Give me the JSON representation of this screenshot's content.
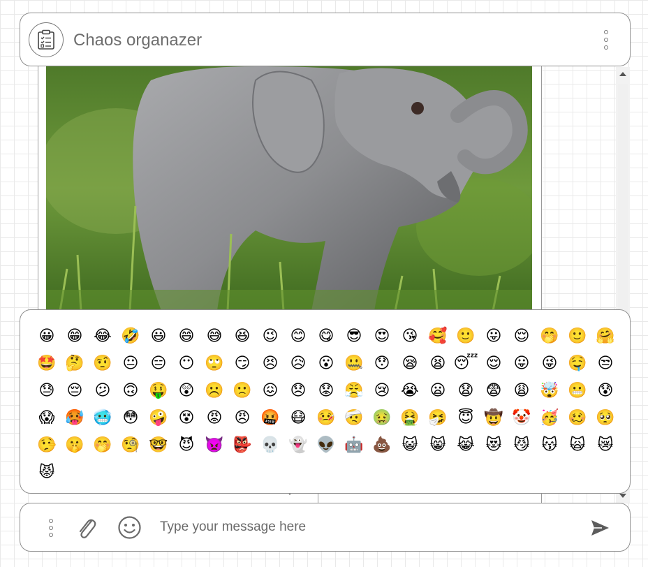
{
  "header": {
    "title": "Chaos organazer",
    "avatar_icon": "clipboard-checklist-icon",
    "menu_icon": "vertical-dots-icon"
  },
  "chat": {
    "image_subject": "photo of a baby elephant figurine on grass"
  },
  "emoji_panel": {
    "emojis": [
      "😀",
      "😁",
      "😂",
      "🤣",
      "😃",
      "😄",
      "😅",
      "😆",
      "😉",
      "😊",
      "😋",
      "😎",
      "😍",
      "😘",
      "🥰",
      "🙂",
      "😛",
      "😌",
      "🤭",
      "🙂",
      "🤗",
      "🤩",
      "🤔",
      "🤨",
      "😐",
      "😑",
      "😶",
      "🙄",
      "😏",
      "😣",
      "😥",
      "😮",
      "🤐",
      "😯",
      "😪",
      "😫",
      "😴",
      "😌",
      "😛",
      "😜",
      "🤤",
      "😒",
      "😓",
      "😔",
      "😕",
      "🙃",
      "🤑",
      "😲",
      "☹️",
      "🙁",
      "😖",
      "😞",
      "😟",
      "😤",
      "😢",
      "😭",
      "😦",
      "😧",
      "😨",
      "😩",
      "🤯",
      "😬",
      "😰",
      "😱",
      "🥵",
      "🥶",
      "😳",
      "🤪",
      "😵",
      "😡",
      "😠",
      "🤬",
      "😷",
      "🤒",
      "🤕",
      "🤢",
      "🤮",
      "🤧",
      "😇",
      "🤠",
      "🤡",
      "🥳",
      "🥴",
      "🥺",
      "🤥",
      "🤫",
      "🤭",
      "🧐",
      "🤓",
      "😈",
      "👿",
      "👺",
      "💀",
      "👻",
      "👽",
      "🤖",
      "💩",
      "😺",
      "😸",
      "😹",
      "😻",
      "😼",
      "😽",
      "🙀",
      "😿",
      "😾"
    ]
  },
  "input_bar": {
    "placeholder": "Type your message here",
    "menu_icon": "vertical-dots-icon",
    "attach_icon": "paperclip-icon",
    "emoji_icon": "smiley-icon",
    "send_icon": "send-icon"
  }
}
